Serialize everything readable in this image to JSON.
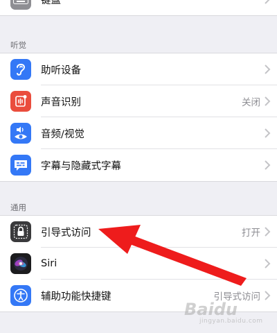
{
  "keyboard_row": {
    "label": "键盘"
  },
  "hearing_section": {
    "header": "听觉",
    "items": [
      {
        "label": "助听设备",
        "value": "",
        "icon": "ear-icon",
        "color": "#3478f6"
      },
      {
        "label": "声音识别",
        "value": "关闭",
        "icon": "sound-recognition-icon",
        "color": "#ea4d3d"
      },
      {
        "label": "音频/视觉",
        "value": "",
        "icon": "audio-visual-icon",
        "color": "#3478f6"
      },
      {
        "label": "字幕与隐藏式字幕",
        "value": "",
        "icon": "subtitles-icon",
        "color": "#3478f6"
      }
    ]
  },
  "general_section": {
    "header": "通用",
    "items": [
      {
        "label": "引导式访问",
        "value": "打开",
        "icon": "lock-icon",
        "color": "#3a3a3c"
      },
      {
        "label": "Siri",
        "value": "",
        "icon": "siri-icon",
        "color": "#1c1c1e"
      },
      {
        "label": "辅助功能快捷键",
        "value": "引导式访问",
        "icon": "accessibility-icon",
        "color": "#3478f6"
      }
    ]
  },
  "annotation": {
    "arrow_color": "#ee1c1c"
  },
  "watermark": {
    "brand": "Baidu",
    "sub": "jingyan.baidu.com"
  }
}
